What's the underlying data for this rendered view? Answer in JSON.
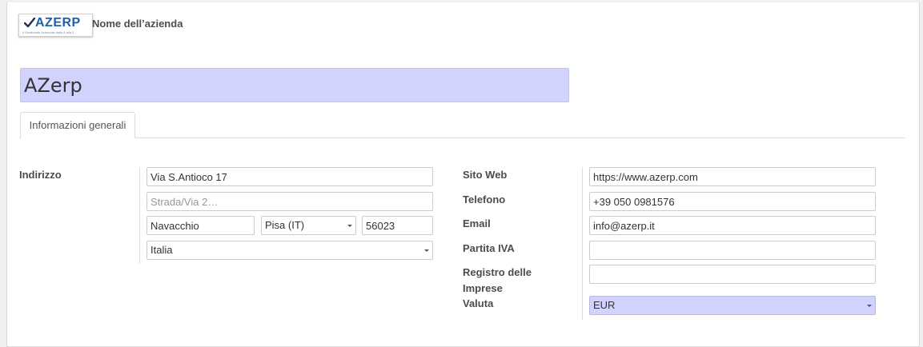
{
  "company": {
    "logo_text": "AZERP",
    "logo_tagline": "Il Gestionale Aziendale dalla A alla Z",
    "logo_label": "Nome dell’azienda",
    "name_value": "AZerp"
  },
  "tabs": [
    {
      "label": "Informazioni generali"
    }
  ],
  "address": {
    "label": "Indirizzo",
    "street": "Via S.Antioco 17",
    "street2_placeholder": "Strada/Via 2…",
    "city": "Navacchio",
    "state": "Pisa (IT)",
    "zip": "56023",
    "country": "Italia"
  },
  "contact": {
    "website_label": "Sito Web",
    "website": "https://www.azerp.com",
    "phone_label": "Telefono",
    "phone": "+39 050 0981576",
    "email_label": "Email",
    "email": "info@azerp.it",
    "vat_label": "Partita IVA",
    "vat": "",
    "registry_label_line1": "Registro delle",
    "registry_label_line2": "Imprese",
    "registry": "",
    "currency_label": "Valuta",
    "currency": "EUR"
  },
  "colors": {
    "required_field_bg": "#d2d2ff",
    "logo_blue": "#1f5fa8"
  }
}
